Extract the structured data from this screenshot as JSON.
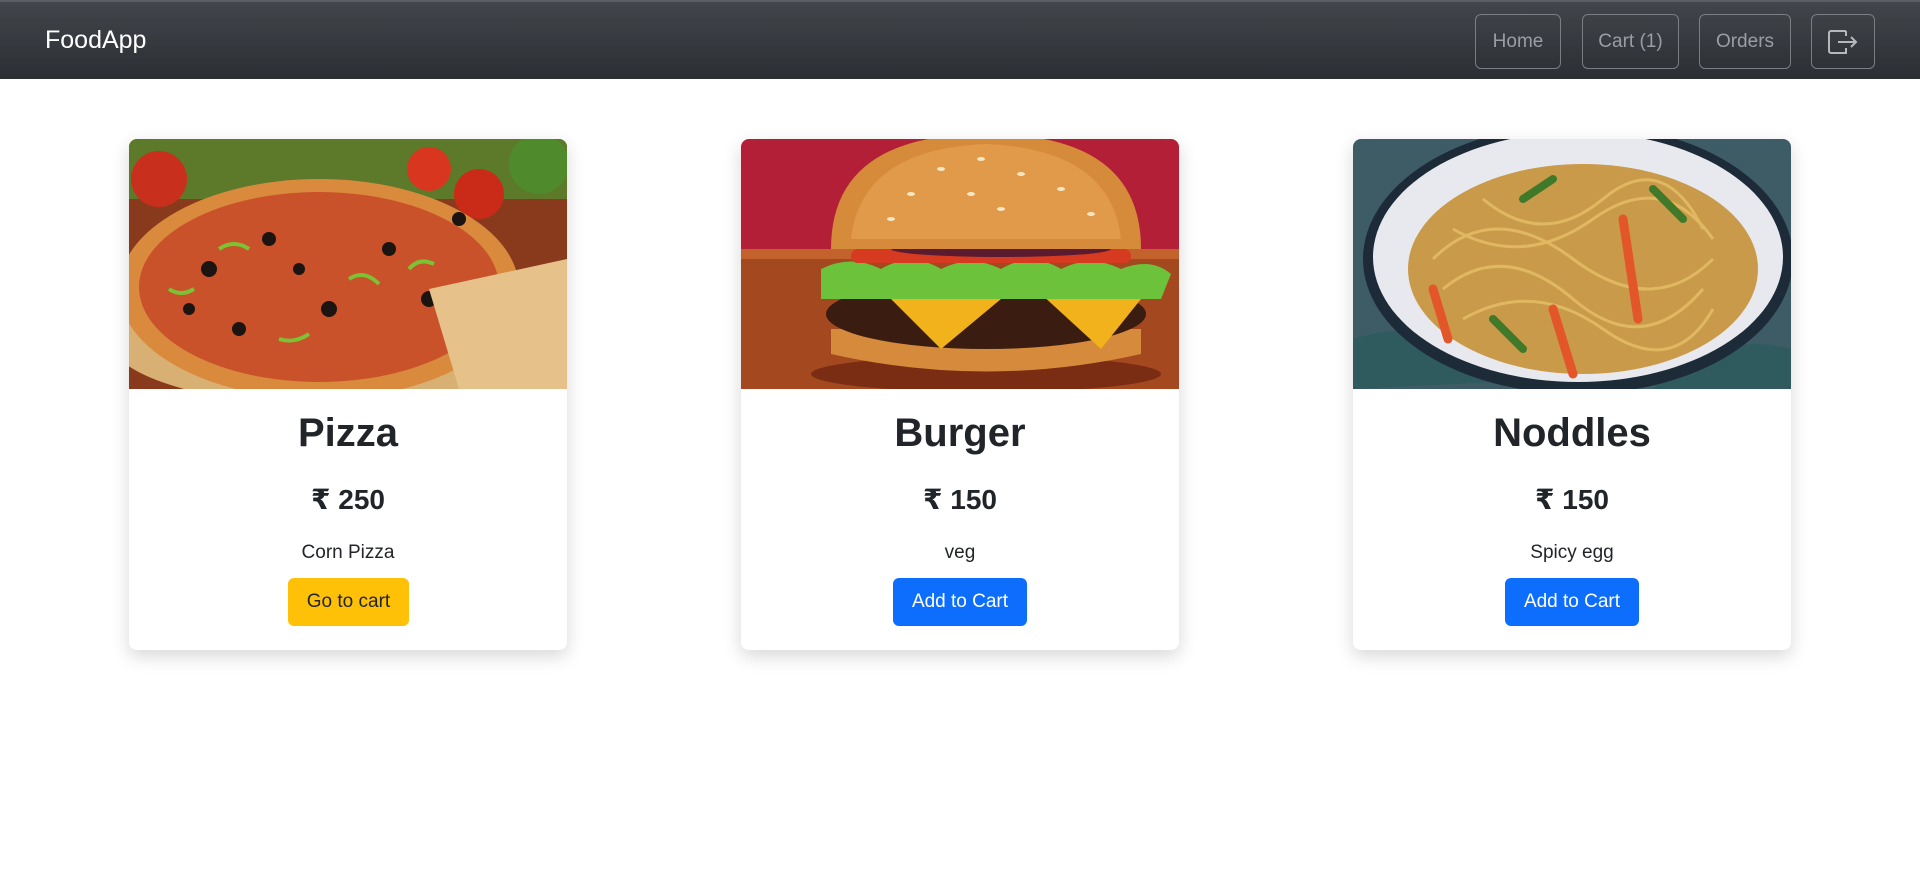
{
  "navbar": {
    "brand": "FoodApp",
    "home_label": "Home",
    "cart_label": "Cart (1)",
    "orders_label": "Orders",
    "logout_icon": "logout-icon"
  },
  "products": [
    {
      "name": "Pizza",
      "price": "₹ 250",
      "description": "Corn Pizza",
      "button_label": "Go to cart",
      "button_color": "#ffc107",
      "image": "pizza-photo"
    },
    {
      "name": "Burger",
      "price": "₹ 150",
      "description": "veg",
      "button_label": "Add to Cart",
      "button_color": "#0d6efd",
      "image": "burger-photo"
    },
    {
      "name": "Noddles",
      "price": "₹ 150",
      "description": "Spicy egg",
      "button_label": "Add to Cart",
      "button_color": "#0d6efd",
      "image": "noodles-photo"
    }
  ]
}
